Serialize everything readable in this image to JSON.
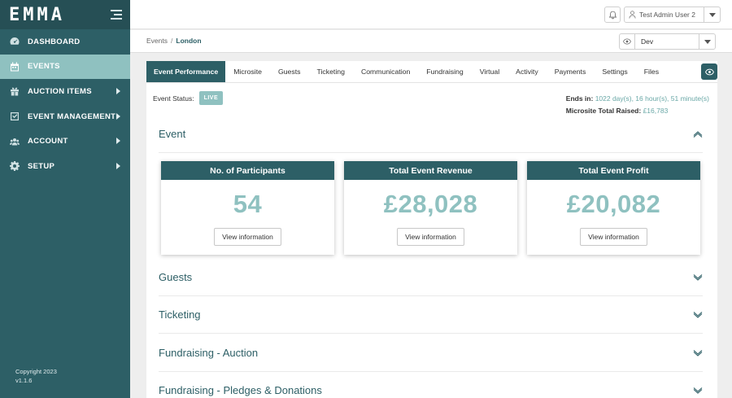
{
  "app": {
    "logo": "EMMA",
    "copyright": "Copyright 2023",
    "version": "v1.1.6"
  },
  "sidebar": {
    "items": [
      {
        "label": "DASHBOARD",
        "icon": "dashboard-gauge-icon"
      },
      {
        "label": "EVENTS",
        "icon": "calendar-icon",
        "active": true
      },
      {
        "label": "AUCTION ITEMS",
        "icon": "gift-icon"
      },
      {
        "label": "EVENT MANAGEMENT",
        "icon": "checkbox-icon"
      },
      {
        "label": "ACCOUNT",
        "icon": "users-icon"
      },
      {
        "label": "SETUP",
        "icon": "gear-icon"
      }
    ]
  },
  "topbar": {
    "user": "Test Admin User 2"
  },
  "breadcrumb": {
    "parent": "Events",
    "separator": "/",
    "current": "London"
  },
  "environment": {
    "selected": "Dev"
  },
  "tabs": [
    "Event Performance",
    "Microsite",
    "Guests",
    "Ticketing",
    "Communication",
    "Fundraising",
    "Virtual",
    "Activity",
    "Payments",
    "Settings",
    "Files"
  ],
  "status": {
    "label": "Event Status:",
    "badge": "LIVE",
    "ends_label": "Ends in:",
    "ends_value": "1022 day(s), 16 hour(s), 51 minute(s)",
    "raised_label": "Microsite Total Raised:",
    "raised_value": "£16,783"
  },
  "sections": {
    "event": "Event",
    "guests": "Guests",
    "ticketing": "Ticketing",
    "auction": "Fundraising - Auction",
    "pledges": "Fundraising - Pledges & Donations"
  },
  "cards": [
    {
      "title": "No. of Participants",
      "value": "54",
      "button": "View information"
    },
    {
      "title": "Total Event Revenue",
      "value": "£28,028",
      "button": "View information"
    },
    {
      "title": "Total Event Profit",
      "value": "£20,082",
      "button": "View information"
    }
  ],
  "colors": {
    "primary": "#2d5f66",
    "accent": "#8fc1c0",
    "background": "#eeeeee"
  }
}
